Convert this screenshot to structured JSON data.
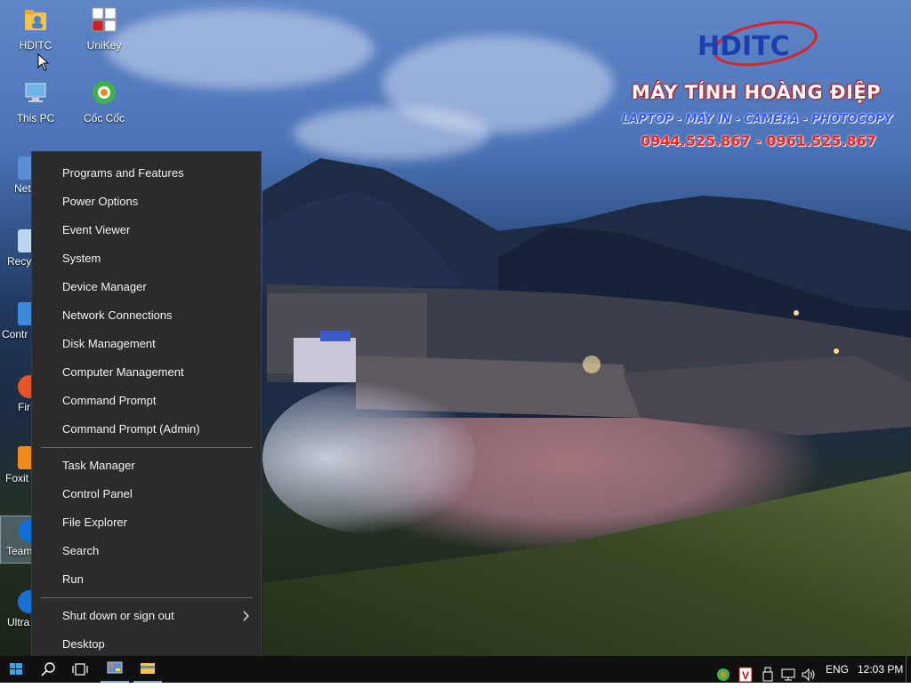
{
  "wallpaper": {
    "brand_title": "MÁY TÍNH HOÀNG ĐIỆP",
    "brand_subtitle": "LAPTOP - MÁY IN - CAMERA - PHOTOCOPY",
    "brand_phones": "0944.525.867 - 0961.525.867",
    "logo_text": "HDITC"
  },
  "desktop_icons": [
    {
      "label": "HDITC",
      "icon": "user-folder-icon"
    },
    {
      "label": "UniKey",
      "icon": "unikey-icon"
    },
    {
      "label": "This PC",
      "icon": "computer-icon"
    },
    {
      "label": "Cốc Cốc",
      "icon": "coccoc-browser-icon"
    },
    {
      "label": "Net",
      "icon": "network-icon"
    },
    {
      "label": "Recy",
      "icon": "recycle-bin-icon"
    },
    {
      "label": "Contr",
      "icon": "control-panel-icon"
    },
    {
      "label": "Fir",
      "icon": "firefox-icon"
    },
    {
      "label": "Foxit",
      "icon": "foxit-reader-icon"
    },
    {
      "label": "Team",
      "icon": "teamviewer-icon"
    },
    {
      "label": "Ultra",
      "icon": "ultraviewer-icon"
    }
  ],
  "context_menu": {
    "group1": [
      "Programs and Features",
      "Power Options",
      "Event Viewer",
      "System",
      "Device Manager",
      "Network Connections",
      "Disk Management",
      "Computer Management",
      "Command Prompt",
      "Command Prompt (Admin)"
    ],
    "group2": [
      "Task Manager",
      "Control Panel",
      "File Explorer",
      "Search",
      "Run"
    ],
    "group3": [
      "Shut down or sign out",
      "Desktop"
    ]
  },
  "taskbar": {
    "language": "ENG",
    "time": "12:03 PM",
    "start_icon": "windows-start-icon",
    "search_icon": "search-icon",
    "task_view_icon": "task-view-icon",
    "pinned": [
      "control-panel-app-icon",
      "file-explorer-icon"
    ],
    "tray": [
      "coccoc-tray-icon",
      "vietnamese-input-icon",
      "usb-device-icon",
      "network-tray-icon",
      "volume-icon"
    ]
  }
}
